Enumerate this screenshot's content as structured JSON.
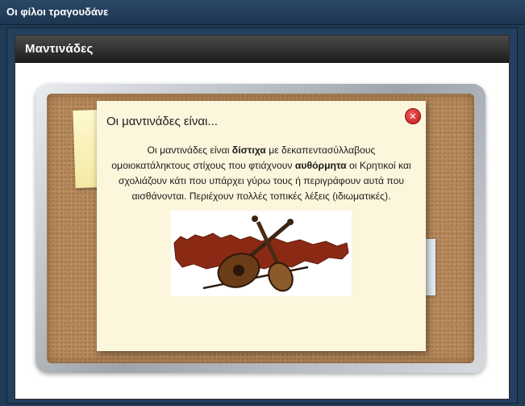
{
  "window": {
    "title": "Οι φίλοι τραγουδάνε"
  },
  "panel": {
    "heading": "Μαντινάδες"
  },
  "popup": {
    "title": "Οι μαντινάδες είναι...",
    "close_icon": "close-icon",
    "text_parts": {
      "p1": "Οι μαντινάδες είναι ",
      "b1": "δίστιχα",
      "p2": " με δεκαπεντασύλλαβους ομοιοκατάληκτους στίχους που φτιάχνουν ",
      "b2": "αυθόρμητα",
      "p3": " οι Κρητικοί και σχολιάζουν κάτι που υπάρχει γύρω τους ή περιγράφουν αυτά που αισθάνονται. Περιέχουν πολλές τοπικές λέξεις (ιδιωματικές)."
    },
    "image_icons": [
      "crete-map",
      "lute-icon",
      "lyra-icon",
      "bow-icon"
    ]
  },
  "colors": {
    "title_bar": "#1d3651",
    "panel_header": "#2a2a2a",
    "cork": "#b78a5b",
    "popup_bg": "#fbf6dc",
    "close_red": "#d42222"
  }
}
